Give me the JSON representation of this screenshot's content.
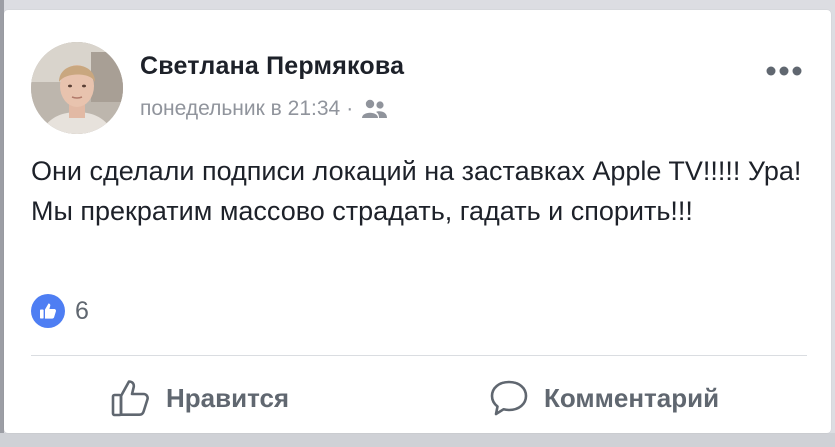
{
  "post": {
    "author": "Светлана Пермякова",
    "timestamp": "понедельник в 21:34",
    "separator": "·",
    "audience_icon": "friends-icon",
    "more_icon": "more-dots-icon",
    "text": "Они сделали подписи локаций на заставках Apple TV!!!!! Ура! Мы прекратим массово страдать, гадать и спорить!!!",
    "reactions": {
      "icon": "like-reaction-icon",
      "count": "6"
    },
    "actions": {
      "like_label": "Нравится",
      "like_icon": "thumbs-up-icon",
      "comment_label": "Комментарий",
      "comment_icon": "comment-bubble-icon"
    }
  },
  "colors": {
    "like_blue": "#4e7ef3",
    "text_dark": "#1d2129",
    "text_gray": "#606770",
    "meta_gray": "#90949c"
  }
}
